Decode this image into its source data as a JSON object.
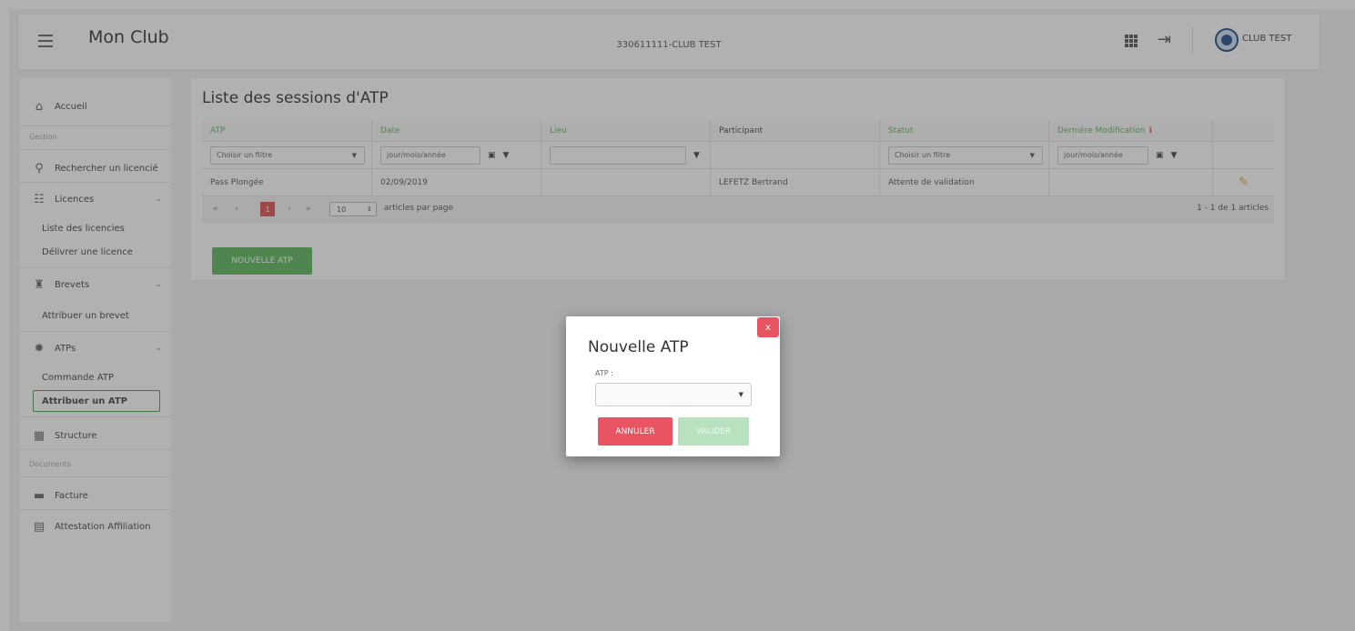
{
  "header": {
    "app_title": "Mon Club",
    "club_code": "330611111-CLUB TEST",
    "club_name": "CLUB TEST"
  },
  "sidebar": {
    "home": "Accueil",
    "section_gestion": "Gestion",
    "search_licence": "Rechercher un licencié",
    "licences": "Licences",
    "licences_list": "Liste des licencies",
    "licences_deliver": "Délivrer une licence",
    "brevets": "Brevets",
    "brevet_assign": "Attribuer un brevet",
    "atps": "ATPs",
    "atp_order": "Commande ATP",
    "atp_assign": "Attribuer un ATP",
    "structure": "Structure",
    "section_documents": "Documents",
    "facture": "Facture",
    "attestation": "Attestation Affiliation"
  },
  "main": {
    "title": "Liste des sessions d'ATP",
    "columns": [
      "ATP",
      "Date",
      "Lieu",
      "Participant",
      "Statut",
      "Dernière Modification"
    ],
    "filters": {
      "atp": "Choisir un filtre",
      "date": "jour/mois/année",
      "statut": "Choisir un filtre",
      "modif": "jour/mois/année"
    },
    "rows": [
      {
        "atp": "Pass Plongée",
        "date": "02/09/2019",
        "lieu": "",
        "participant": "LEFETZ Bertrand",
        "statut": "Attente de validation",
        "modif": ""
      }
    ],
    "pagination": {
      "first": "«",
      "prev": "‹",
      "current": "1",
      "next": "›",
      "last": "»",
      "per_page": "10",
      "per_page_label": "articles par page",
      "count": "1 - 1 de 1 articles"
    },
    "new_button": "NOUVELLE ATP"
  },
  "modal": {
    "title": "Nouvelle ATP",
    "label": "ATP :",
    "close": "x",
    "select_value": "",
    "cancel": "ANNULER",
    "validate": "VALIDER"
  },
  "colors": {
    "green": "#5cb85c",
    "red": "#e95462",
    "overlay": "rgba(60,60,60,0.40)"
  },
  "icons": [
    "menu-icon",
    "apps-grid-icon",
    "logout-icon",
    "club-logo-icon",
    "home-icon",
    "search-icon",
    "users-icon",
    "trophy-icon",
    "gear-icon",
    "building-icon",
    "folder-icon",
    "document-icon",
    "calendar-icon",
    "filter-icon",
    "edit-icon",
    "chevron-down-icon",
    "info-icon"
  ]
}
